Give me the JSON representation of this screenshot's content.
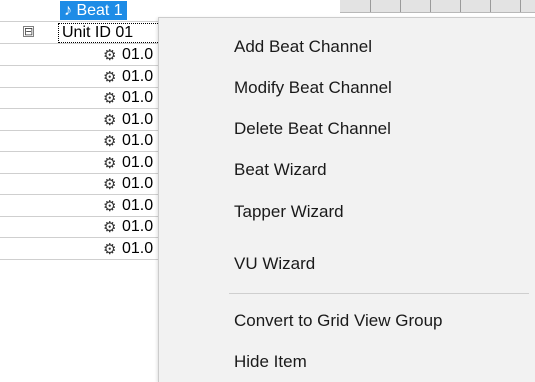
{
  "tree": {
    "beat_node": {
      "icon": "music-note-icon",
      "label": "♪ Beat 1"
    },
    "unit_node": {
      "expander": "⊟",
      "label": "Unit ID 01"
    },
    "items": [
      {
        "icon": "gear-icon",
        "label": "01.0"
      },
      {
        "icon": "gear-icon",
        "label": "01.0"
      },
      {
        "icon": "gear-icon",
        "label": "01.0"
      },
      {
        "icon": "gear-icon",
        "label": "01.0"
      },
      {
        "icon": "gear-icon",
        "label": "01.0"
      },
      {
        "icon": "gear-icon",
        "label": "01.0"
      },
      {
        "icon": "gear-icon",
        "label": "01.0"
      },
      {
        "icon": "gear-icon",
        "label": "01.0"
      },
      {
        "icon": "gear-icon",
        "label": "01.0"
      },
      {
        "icon": "gear-icon",
        "label": "01.0"
      }
    ]
  },
  "context_menu": {
    "items": [
      {
        "label": "Add Beat Channel"
      },
      {
        "label": "Modify Beat Channel"
      },
      {
        "label": "Delete Beat Channel"
      },
      {
        "label": "Beat Wizard"
      },
      {
        "label": "Tapper Wizard"
      },
      {
        "label": "VU Wizard"
      },
      {
        "label": "Convert to Grid View Group"
      },
      {
        "label": "Hide Item"
      }
    ]
  },
  "colors": {
    "selection": "#1e8ce6",
    "menu_background": "#f2f2f2"
  }
}
